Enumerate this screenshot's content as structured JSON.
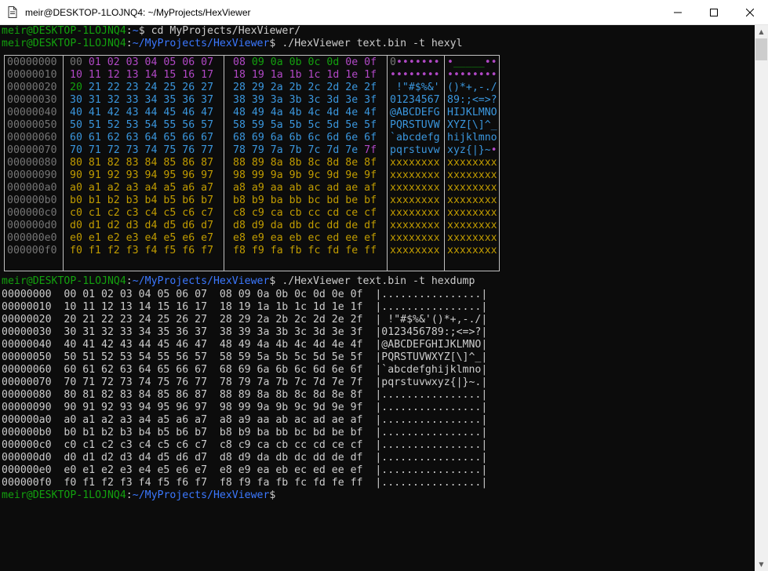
{
  "window": {
    "title": "meir@DESKTOP-1LOJNQ4: ~/MyProjects/HexViewer",
    "app_icon": "file-icon",
    "buttons": {
      "minimize": "—",
      "maximize": "☐",
      "close": "✕"
    }
  },
  "prompt": {
    "user_host": "meir@DESKTOP-1LOJNQ4",
    "home_path": "~",
    "project_path": "~/MyProjects/HexViewer"
  },
  "commands": {
    "cd": "cd MyProjects/HexViewer/",
    "hexyl": "./HexViewer text.bin -t hexyl",
    "hexdump": "./HexViewer text.bin -t hexdump"
  },
  "hexyl": {
    "rows": [
      {
        "offset": "00000000",
        "hex1": [
          "00",
          "01",
          "02",
          "03",
          "04",
          "05",
          "06",
          "07"
        ],
        "hex2": [
          "08",
          "09",
          "0a",
          "0b",
          "0c",
          "0d",
          "0e",
          "0f"
        ],
        "ascii1": "0•••••••",
        "ascii2": "•_____••"
      },
      {
        "offset": "00000010",
        "hex1": [
          "10",
          "11",
          "12",
          "13",
          "14",
          "15",
          "16",
          "17"
        ],
        "hex2": [
          "18",
          "19",
          "1a",
          "1b",
          "1c",
          "1d",
          "1e",
          "1f"
        ],
        "ascii1": "••••••••",
        "ascii2": "••••••••"
      },
      {
        "offset": "00000020",
        "hex1": [
          "20",
          "21",
          "22",
          "23",
          "24",
          "25",
          "26",
          "27"
        ],
        "hex2": [
          "28",
          "29",
          "2a",
          "2b",
          "2c",
          "2d",
          "2e",
          "2f"
        ],
        "ascii1": " !\"#$%&'",
        "ascii2": "()*+,-./"
      },
      {
        "offset": "00000030",
        "hex1": [
          "30",
          "31",
          "32",
          "33",
          "34",
          "35",
          "36",
          "37"
        ],
        "hex2": [
          "38",
          "39",
          "3a",
          "3b",
          "3c",
          "3d",
          "3e",
          "3f"
        ],
        "ascii1": "01234567",
        "ascii2": "89:;<=>?"
      },
      {
        "offset": "00000040",
        "hex1": [
          "40",
          "41",
          "42",
          "43",
          "44",
          "45",
          "46",
          "47"
        ],
        "hex2": [
          "48",
          "49",
          "4a",
          "4b",
          "4c",
          "4d",
          "4e",
          "4f"
        ],
        "ascii1": "@ABCDEFG",
        "ascii2": "HIJKLMNO"
      },
      {
        "offset": "00000050",
        "hex1": [
          "50",
          "51",
          "52",
          "53",
          "54",
          "55",
          "56",
          "57"
        ],
        "hex2": [
          "58",
          "59",
          "5a",
          "5b",
          "5c",
          "5d",
          "5e",
          "5f"
        ],
        "ascii1": "PQRSTUVW",
        "ascii2": "XYZ[\\]^_"
      },
      {
        "offset": "00000060",
        "hex1": [
          "60",
          "61",
          "62",
          "63",
          "64",
          "65",
          "66",
          "67"
        ],
        "hex2": [
          "68",
          "69",
          "6a",
          "6b",
          "6c",
          "6d",
          "6e",
          "6f"
        ],
        "ascii1": "`abcdefg",
        "ascii2": "hijklmno"
      },
      {
        "offset": "00000070",
        "hex1": [
          "70",
          "71",
          "72",
          "73",
          "74",
          "75",
          "76",
          "77"
        ],
        "hex2": [
          "78",
          "79",
          "7a",
          "7b",
          "7c",
          "7d",
          "7e",
          "7f"
        ],
        "ascii1": "pqrstuvw",
        "ascii2": "xyz{|}~•"
      },
      {
        "offset": "00000080",
        "hex1": [
          "80",
          "81",
          "82",
          "83",
          "84",
          "85",
          "86",
          "87"
        ],
        "hex2": [
          "88",
          "89",
          "8a",
          "8b",
          "8c",
          "8d",
          "8e",
          "8f"
        ],
        "ascii1": "xxxxxxxx",
        "ascii2": "xxxxxxxx"
      },
      {
        "offset": "00000090",
        "hex1": [
          "90",
          "91",
          "92",
          "93",
          "94",
          "95",
          "96",
          "97"
        ],
        "hex2": [
          "98",
          "99",
          "9a",
          "9b",
          "9c",
          "9d",
          "9e",
          "9f"
        ],
        "ascii1": "xxxxxxxx",
        "ascii2": "xxxxxxxx"
      },
      {
        "offset": "000000a0",
        "hex1": [
          "a0",
          "a1",
          "a2",
          "a3",
          "a4",
          "a5",
          "a6",
          "a7"
        ],
        "hex2": [
          "a8",
          "a9",
          "aa",
          "ab",
          "ac",
          "ad",
          "ae",
          "af"
        ],
        "ascii1": "xxxxxxxx",
        "ascii2": "xxxxxxxx"
      },
      {
        "offset": "000000b0",
        "hex1": [
          "b0",
          "b1",
          "b2",
          "b3",
          "b4",
          "b5",
          "b6",
          "b7"
        ],
        "hex2": [
          "b8",
          "b9",
          "ba",
          "bb",
          "bc",
          "bd",
          "be",
          "bf"
        ],
        "ascii1": "xxxxxxxx",
        "ascii2": "xxxxxxxx"
      },
      {
        "offset": "000000c0",
        "hex1": [
          "c0",
          "c1",
          "c2",
          "c3",
          "c4",
          "c5",
          "c6",
          "c7"
        ],
        "hex2": [
          "c8",
          "c9",
          "ca",
          "cb",
          "cc",
          "cd",
          "ce",
          "cf"
        ],
        "ascii1": "xxxxxxxx",
        "ascii2": "xxxxxxxx"
      },
      {
        "offset": "000000d0",
        "hex1": [
          "d0",
          "d1",
          "d2",
          "d3",
          "d4",
          "d5",
          "d6",
          "d7"
        ],
        "hex2": [
          "d8",
          "d9",
          "da",
          "db",
          "dc",
          "dd",
          "de",
          "df"
        ],
        "ascii1": "xxxxxxxx",
        "ascii2": "xxxxxxxx"
      },
      {
        "offset": "000000e0",
        "hex1": [
          "e0",
          "e1",
          "e2",
          "e3",
          "e4",
          "e5",
          "e6",
          "e7"
        ],
        "hex2": [
          "e8",
          "e9",
          "ea",
          "eb",
          "ec",
          "ed",
          "ee",
          "ef"
        ],
        "ascii1": "xxxxxxxx",
        "ascii2": "xxxxxxxx"
      },
      {
        "offset": "000000f0",
        "hex1": [
          "f0",
          "f1",
          "f2",
          "f3",
          "f4",
          "f5",
          "f6",
          "f7"
        ],
        "hex2": [
          "f8",
          "f9",
          "fa",
          "fb",
          "fc",
          "fd",
          "fe",
          "ff"
        ],
        "ascii1": "xxxxxxxx",
        "ascii2": "xxxxxxxx"
      }
    ]
  },
  "hexdump": {
    "lines": [
      "00000000  00 01 02 03 04 05 06 07  08 09 0a 0b 0c 0d 0e 0f  |................|",
      "00000010  10 11 12 13 14 15 16 17  18 19 1a 1b 1c 1d 1e 1f  |................|",
      "00000020  20 21 22 23 24 25 26 27  28 29 2a 2b 2c 2d 2e 2f  | !\"#$%&'()*+,-./|",
      "00000030  30 31 32 33 34 35 36 37  38 39 3a 3b 3c 3d 3e 3f  |0123456789:;<=>?|",
      "00000040  40 41 42 43 44 45 46 47  48 49 4a 4b 4c 4d 4e 4f  |@ABCDEFGHIJKLMNO|",
      "00000050  50 51 52 53 54 55 56 57  58 59 5a 5b 5c 5d 5e 5f  |PQRSTUVWXYZ[\\]^_|",
      "00000060  60 61 62 63 64 65 66 67  68 69 6a 6b 6c 6d 6e 6f  |`abcdefghijklmno|",
      "00000070  70 71 72 73 74 75 76 77  78 79 7a 7b 7c 7d 7e 7f  |pqrstuvwxyz{|}~.|",
      "00000080  80 81 82 83 84 85 86 87  88 89 8a 8b 8c 8d 8e 8f  |................|",
      "00000090  90 91 92 93 94 95 96 97  98 99 9a 9b 9c 9d 9e 9f  |................|",
      "000000a0  a0 a1 a2 a3 a4 a5 a6 a7  a8 a9 aa ab ac ad ae af  |................|",
      "000000b0  b0 b1 b2 b3 b4 b5 b6 b7  b8 b9 ba bb bc bd be bf  |................|",
      "000000c0  c0 c1 c2 c3 c4 c5 c6 c7  c8 c9 ca cb cc cd ce cf  |................|",
      "000000d0  d0 d1 d2 d3 d4 d5 d6 d7  d8 d9 da db dc dd de df  |................|",
      "000000e0  e0 e1 e2 e3 e4 e5 e6 e7  e8 e9 ea eb ec ed ee ef  |................|",
      "000000f0  f0 f1 f2 f3 f4 f5 f6 f7  f8 f9 fa fb fc fd fe ff  |................|"
    ]
  },
  "colors": {
    "background": "#0c0c0c",
    "text": "#cccccc",
    "prompt_green": "#13a10e",
    "path_blue": "#3b78ff",
    "offset_gray": "#767676",
    "null_gray": "#767676",
    "control_purple": "#b148c6",
    "whitespace_green": "#13a10e",
    "printable_cyan": "#3a96dd",
    "nonascii_yellow": "#c19c00"
  }
}
